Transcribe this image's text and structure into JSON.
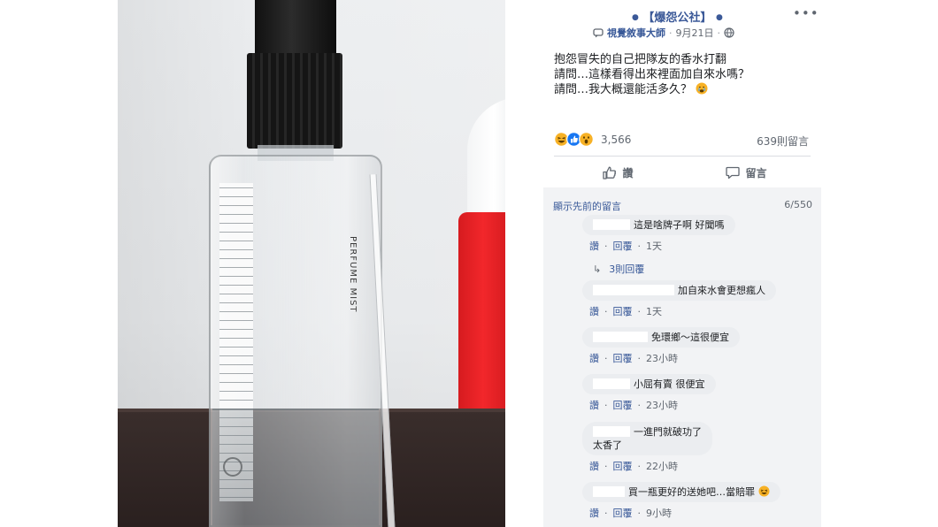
{
  "post": {
    "page_name": "【爆怨公社】",
    "author": "視覺敘事大師",
    "date": "9月21日",
    "lines": [
      "抱怨冒失的自己把隊友的香水打翻",
      "請問…這樣看得出來裡面加自來水嗎？",
      "請問…我大概還能活多久？"
    ],
    "reaction_count": "3,566",
    "comment_count": "639則留言",
    "like_label": "讚",
    "comment_label": "留言"
  },
  "comments_section": {
    "prev_label": "顯示先前的留言",
    "count": "6/550",
    "items": [
      {
        "text": "這是啥牌子啊 好聞嗎",
        "like": "讚",
        "reply": "回覆",
        "time": "1天"
      },
      {
        "text": "加自來水會更想瘋人",
        "like": "讚",
        "reply": "回覆",
        "time": "1天"
      },
      {
        "text": "免環鄉～這很便宜",
        "like": "讚",
        "reply": "回覆",
        "time": "23小時"
      },
      {
        "text": "小屈有賣 很便宜",
        "like": "讚",
        "reply": "回覆",
        "time": "23小時"
      },
      {
        "text_line1": "一進門就破功了",
        "text_line2": "太香了",
        "like": "讚",
        "reply": "回覆",
        "time": "22小時"
      },
      {
        "text": "買一瓶更好的送她吧…當賠罪",
        "like": "讚",
        "reply": "回覆",
        "time": "9小時"
      }
    ],
    "replies_label": "3則回覆"
  },
  "photo": {
    "bottle_text": "PERFUME MIST"
  },
  "colors": {
    "link": "#385898",
    "page_name": "#3b5998",
    "comment_bg": "#f2f3f5",
    "bubble_bg": "#ebedf0",
    "like_reaction": "#1877f2",
    "haha_reaction": "#f7b125"
  }
}
